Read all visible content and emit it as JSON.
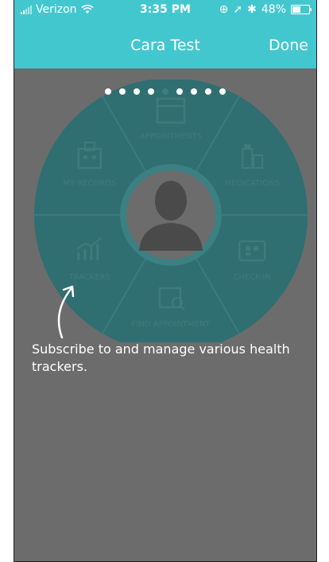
{
  "status_bar": {
    "carrier": "Verizon",
    "time": "3:35 PM",
    "battery": "48%",
    "battery_level": 0.48
  },
  "nav_bar": {
    "title": "Cara Test",
    "done_label": "Done"
  },
  "pager": {
    "count": 9,
    "active": 4
  },
  "wheel": {
    "segments": [
      {
        "label": "APPOINTMENTS",
        "icon": "calendar-icon"
      },
      {
        "label": "MEDICATIONS",
        "icon": "medication-bottles-icon"
      },
      {
        "label": "CHECK-IN",
        "icon": "qr-ticket-icon"
      },
      {
        "label": "FIND APPOINTMENT",
        "icon": "calendar-search-icon"
      },
      {
        "label": "TRACKERS",
        "icon": "chart-trend-icon"
      },
      {
        "label": "MY RECORDS",
        "icon": "hospital-building-icon"
      }
    ],
    "center_icon": "avatar-silhouette-icon"
  },
  "hint": {
    "text": "Subscribe to and manage various health trackers."
  },
  "colors": {
    "accent": "#43c7cf",
    "overlay": "#6c6c6c",
    "wheel": "#2f6e71"
  }
}
